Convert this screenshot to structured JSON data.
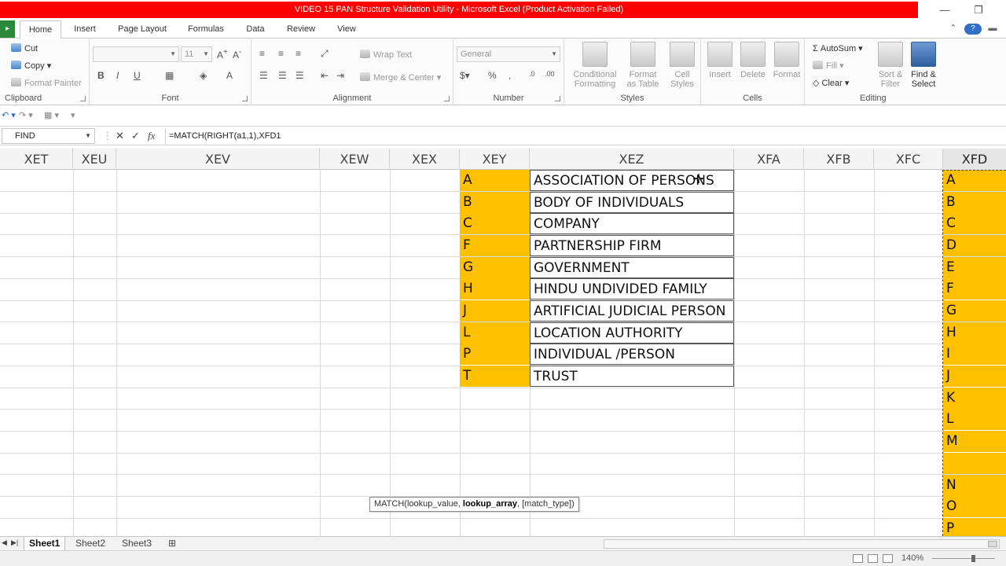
{
  "window": {
    "title": "VIDEO 15 PAN Structure Validation Utility  -  Microsoft Excel (Product Activation Failed)",
    "minimize": "—",
    "restore": "❐"
  },
  "ribbon_tabs": {
    "file": "File",
    "items": [
      "Home",
      "Insert",
      "Page Layout",
      "Formulas",
      "Data",
      "Review",
      "View"
    ],
    "active": "Home"
  },
  "clipboard": {
    "cut": "Cut",
    "copy": "Copy",
    "format_painter": "Format Painter",
    "label": "Clipboard"
  },
  "font": {
    "name": "",
    "size": "11",
    "label": "Font",
    "bold": "B",
    "italic": "I",
    "underline": "U"
  },
  "alignment": {
    "wrap_text": "Wrap Text",
    "merge_center": "Merge & Center",
    "label": "Alignment"
  },
  "number": {
    "format": "General",
    "label": "Number"
  },
  "styles": {
    "conditional_formatting": [
      "Conditional",
      "Formatting"
    ],
    "format_as_table": [
      "Format",
      "as Table"
    ],
    "cell_styles": [
      "Cell",
      "Styles"
    ],
    "label": "Styles"
  },
  "cells": {
    "insert": "Insert",
    "delete": "Delete",
    "format": "Format",
    "label": "Cells"
  },
  "editing": {
    "autosum": "AutoSum",
    "fill": "Fill",
    "clear": "Clear",
    "sort_filter": [
      "Sort &",
      "Filter"
    ],
    "find_select": [
      "Find &",
      "Select"
    ],
    "label": "Editing"
  },
  "formula_bar": {
    "name_box": "FIND",
    "cancel": "✕",
    "enter": "✓",
    "fx": "fx",
    "formula": "=MATCH(RIGHT(a1,1),XFD1"
  },
  "columns": [
    "XET",
    "XEU",
    "XEV",
    "XEW",
    "XEX",
    "XEY",
    "XEZ",
    "XFA",
    "XFB",
    "XFC",
    "XFD"
  ],
  "table_rows": [
    {
      "code": "A",
      "desc": "ASSOCIATION OF PERSONS"
    },
    {
      "code": "B",
      "desc": "BODY OF INDIVIDUALS"
    },
    {
      "code": "C",
      "desc": "COMPANY"
    },
    {
      "code": "F",
      "desc": "PARTNERSHIP FIRM"
    },
    {
      "code": "G",
      "desc": "GOVERNMENT"
    },
    {
      "code": "H",
      "desc": "HINDU UNDIVIDED FAMILY"
    },
    {
      "code": "J",
      "desc": "ARTIFICIAL JUDICIAL PERSON"
    },
    {
      "code": "L",
      "desc": "LOCATION AUTHORITY"
    },
    {
      "code": "P",
      "desc": "INDIVIDUAL /PERSON"
    },
    {
      "code": "T",
      "desc": "TRUST"
    }
  ],
  "xfd_values": [
    "A",
    "B",
    "C",
    "D",
    "E",
    "F",
    "G",
    "H",
    "I",
    "J",
    "K",
    "L",
    "M",
    "",
    "N",
    "O",
    "P"
  ],
  "tooltip": {
    "prefix": "MATCH(lookup_value, ",
    "bold": "lookup_array",
    "suffix": ", [match_type])"
  },
  "sheets": [
    "Sheet1",
    "Sheet2",
    "Sheet3"
  ],
  "active_sheet": "Sheet1",
  "status": {
    "zoom": "140%"
  },
  "colors": {
    "title_bar": "#ff0000",
    "highlight": "#ffc000",
    "file_tab": "#2a8a3a"
  }
}
